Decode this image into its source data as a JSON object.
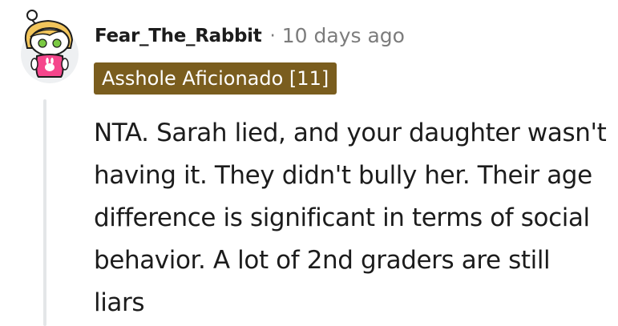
{
  "comment": {
    "username": "Fear_The_Rabbit",
    "separator": "·",
    "timestamp": "10 days ago",
    "flair": {
      "text": "Asshole Aficionado [11]",
      "background_color": "#7a5d1e",
      "text_color": "#ffffff"
    },
    "body": "NTA. Sarah lied, and your daughter wasn't having it. They didn't bully her. Their age difference is significant in terms of social behavior. A lot of 2nd graders are still liars",
    "avatar": {
      "icon": "snoo-avatar-icon",
      "shirt_color": "#f5468c",
      "hair_color": "#f2c55c",
      "eye_color": "#7ac943"
    },
    "thread_line_color": "#e4e6e8"
  }
}
